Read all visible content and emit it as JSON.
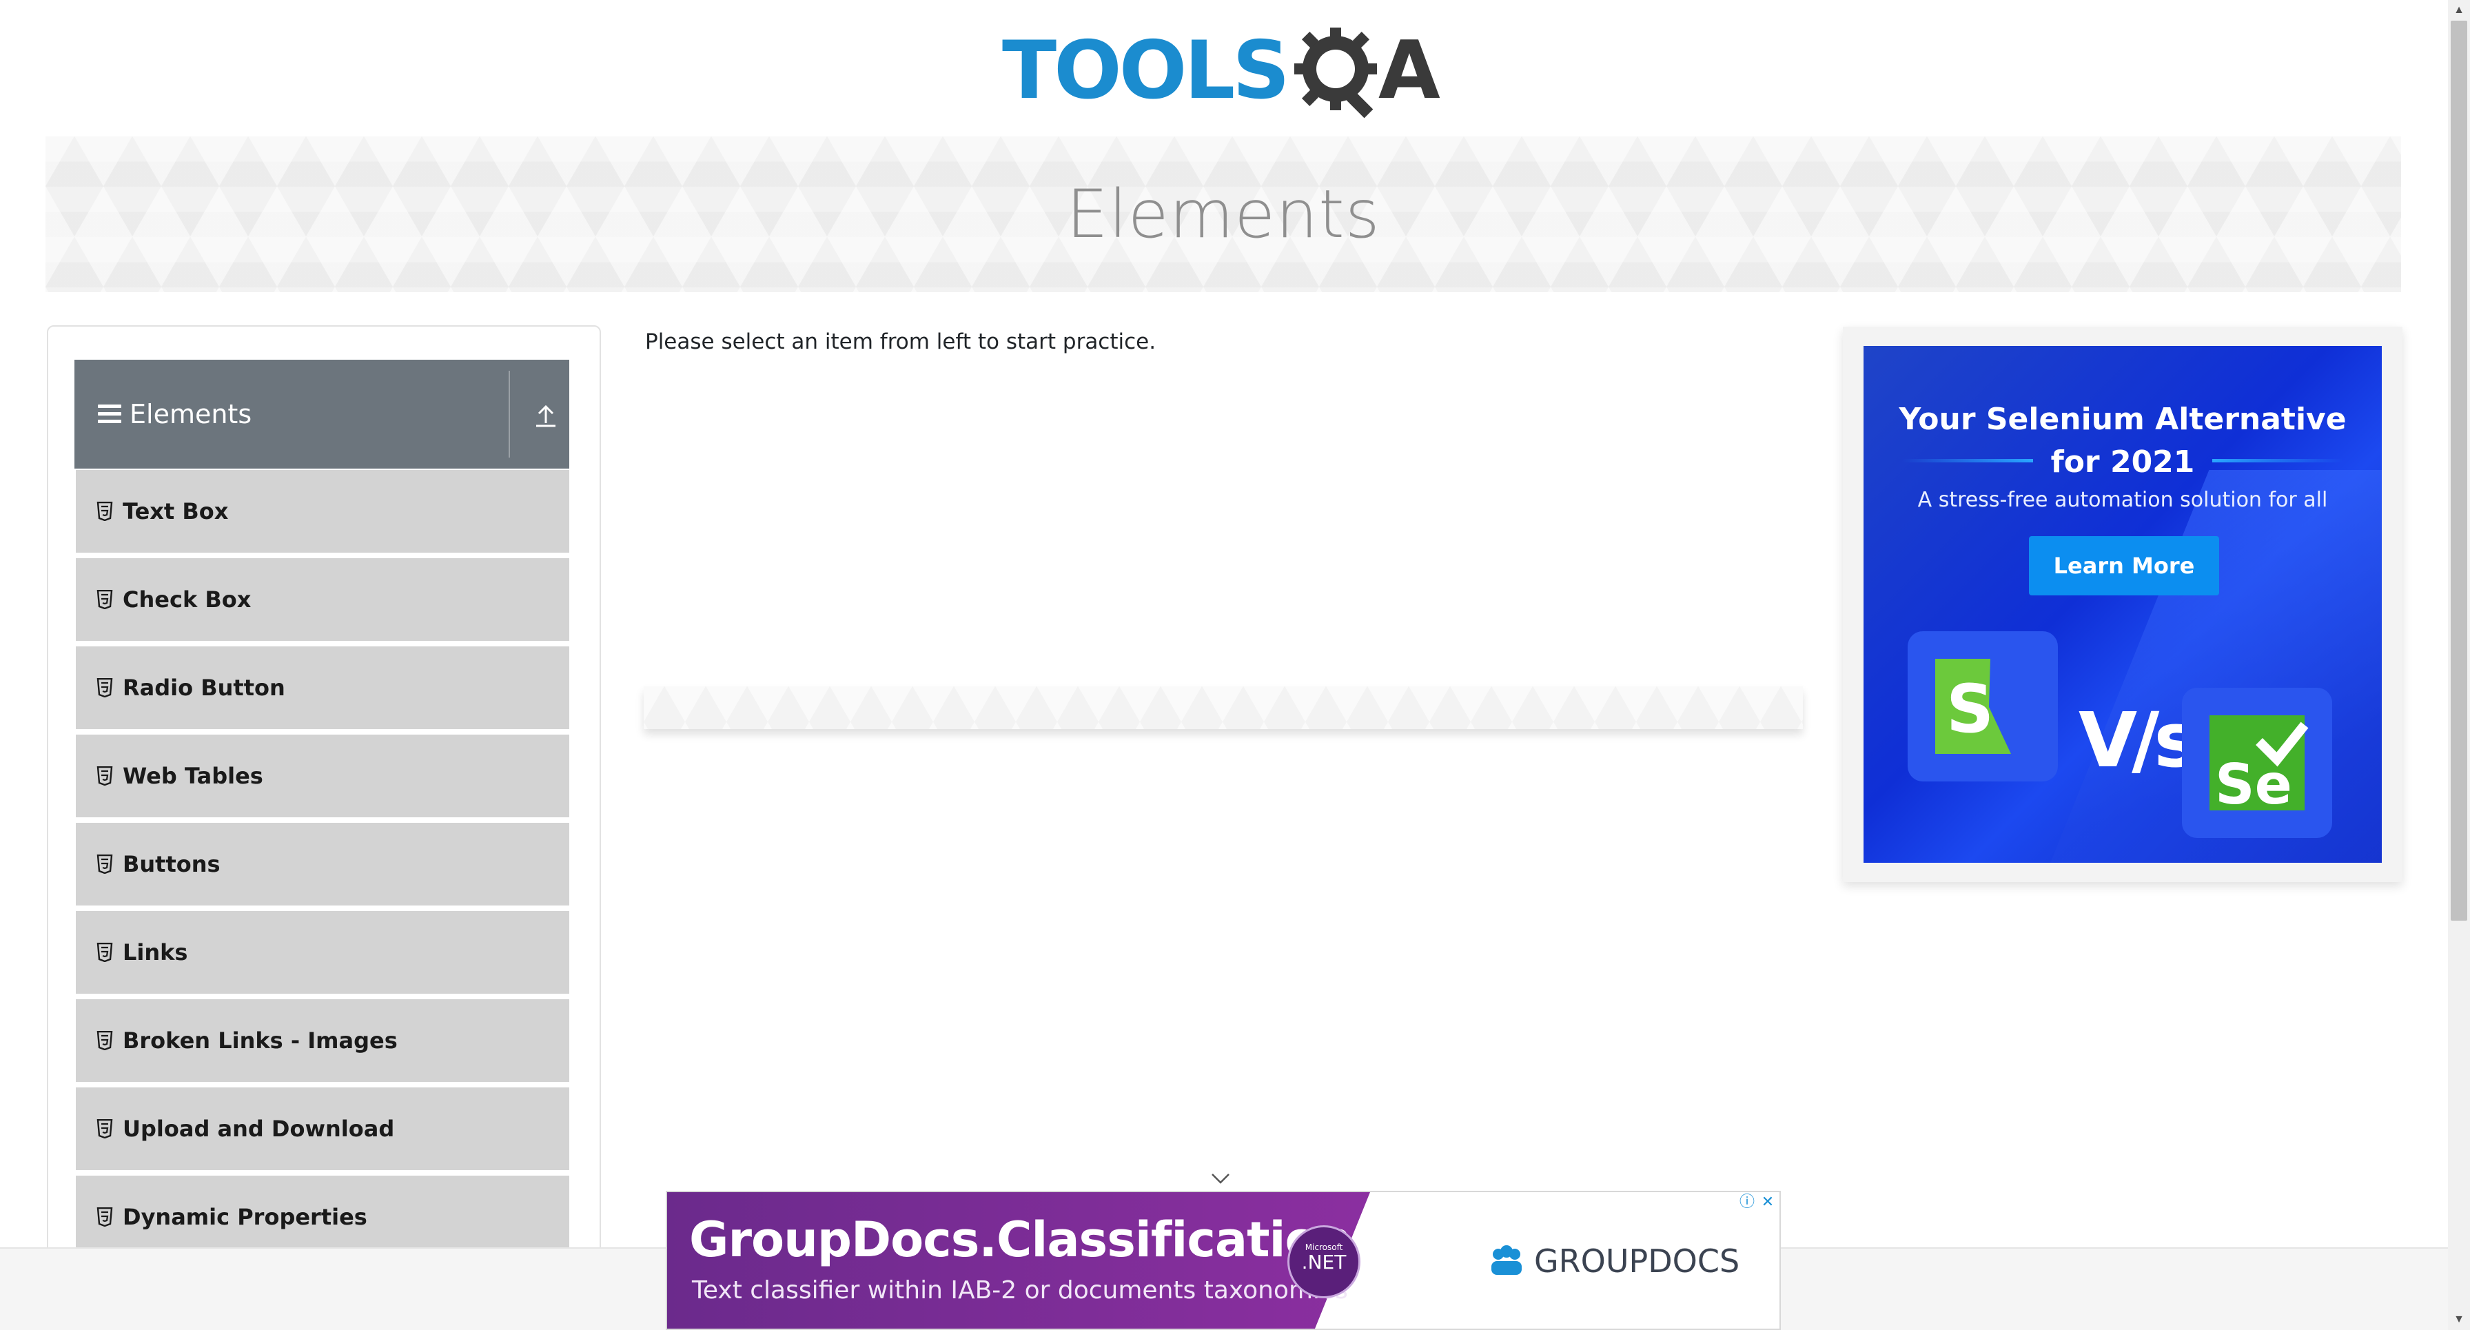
{
  "header": {
    "logo": {
      "word": "TOOLS",
      "mark": "QA",
      "icon": "gear-magnifier-icon",
      "colors": {
        "word": "#1b8ccf",
        "mark": "#3a3a3a"
      }
    }
  },
  "banner": {
    "title": "Elements"
  },
  "sidebar": {
    "group": {
      "label": "Elements",
      "menu_icon": "hamburger-icon",
      "collapse_icon": "arrow-up-icon"
    },
    "items": [
      {
        "label": "Text Box",
        "icon": "html5-shield-icon"
      },
      {
        "label": "Check Box",
        "icon": "html5-shield-icon"
      },
      {
        "label": "Radio Button",
        "icon": "html5-shield-icon"
      },
      {
        "label": "Web Tables",
        "icon": "html5-shield-icon"
      },
      {
        "label": "Buttons",
        "icon": "html5-shield-icon"
      },
      {
        "label": "Links",
        "icon": "html5-shield-icon"
      },
      {
        "label": "Broken Links - Images",
        "icon": "html5-shield-icon"
      },
      {
        "label": "Upload and Download",
        "icon": "html5-shield-icon"
      },
      {
        "label": "Dynamic Properties",
        "icon": "html5-shield-icon"
      }
    ]
  },
  "main": {
    "message": "Please select an item from left to start practice."
  },
  "right_ad": {
    "headline_line1": "Your Selenium Alternative",
    "headline_line2": "for 2021",
    "subtitle": "A stress-free automation solution for all",
    "button_label": "Learn More",
    "vs_text": "V/s",
    "left_logo": "S",
    "right_logo": "Se",
    "colors": {
      "background": "#1435d6",
      "button": "#0c8ef0"
    }
  },
  "bottom_ad": {
    "title": "GroupDocs.Classification",
    "subtitle": "Text classifier within IAB-2 or documents taxonomies",
    "badge_small": "Microsoft",
    "badge_big": ".NET",
    "brand": "GROUPDOCS",
    "info_icon": "info-icon",
    "close_icon": "close-icon",
    "toggle_icon": "chevron-down-icon",
    "colors": {
      "band": "#7a2c95",
      "brand_text": "#3b4351"
    }
  },
  "scrollbar": {
    "up_icon": "scroll-up-arrow-icon",
    "down_icon": "scroll-down-arrow-icon"
  }
}
